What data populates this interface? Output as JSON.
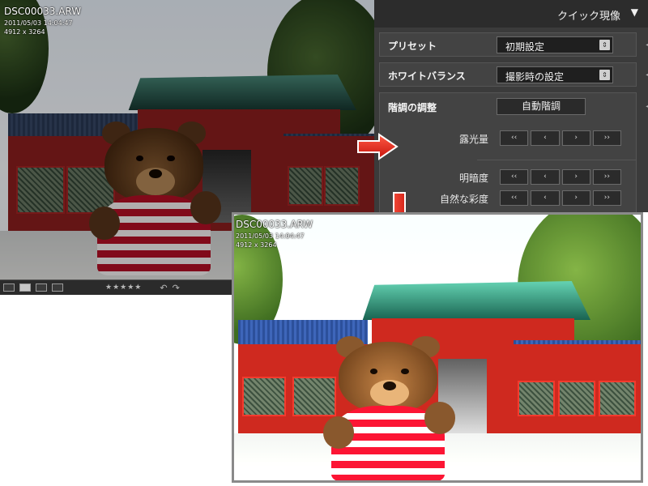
{
  "before": {
    "filename": "DSC00033.ARW",
    "datetime": "2011/05/03 14:04:47",
    "dimensions": "4912 x 3264",
    "toolbar": {
      "view_icons": [
        "single-view-icon",
        "grid-view-icon",
        "compare-view-icon",
        "survey-view-icon"
      ],
      "rating_stars": "★★★★★",
      "rotate_left": "↶",
      "rotate_right": "↷"
    }
  },
  "panel": {
    "title": "クイック現像",
    "collapse_symbol": "▼",
    "rows": {
      "preset": {
        "label": "プリセット",
        "value": "初期設定"
      },
      "white_balance": {
        "label": "ホワイトバランス",
        "value": "撮影時の設定"
      },
      "tone": {
        "label": "階調の調整",
        "auto_button": "自動階調",
        "controls": [
          {
            "label": "露光量",
            "steps": [
              "‹‹",
              "‹",
              "›",
              "››"
            ]
          },
          {
            "label": "明暗度",
            "steps": [
              "‹‹",
              "‹",
              "›",
              "››"
            ]
          },
          {
            "label": "自然な彩度",
            "steps": [
              "‹‹",
              "‹",
              "›",
              "››"
            ]
          }
        ]
      }
    },
    "spin_symbol": "⇕",
    "row_triangle": "◀"
  },
  "after": {
    "filename": "DSC00033.ARW",
    "datetime": "2011/05/03 14:04:47",
    "dimensions": "4912 x 3264"
  },
  "colors": {
    "arrow": "#e8271d",
    "panel_bg": "#3b3b3b",
    "panel_header": "#2c2c2c"
  }
}
